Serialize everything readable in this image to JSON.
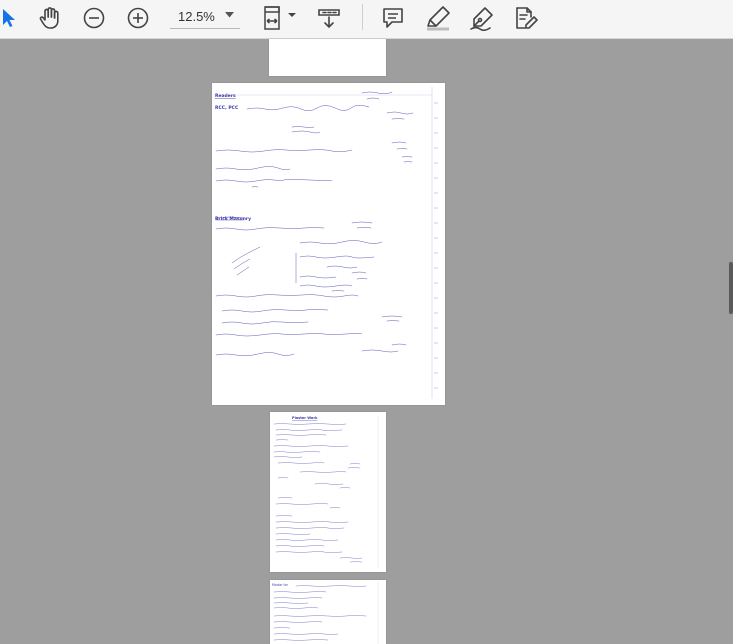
{
  "toolbar": {
    "zoom_value": "12.5%",
    "tools": [
      "select-tool",
      "hand-tool",
      "zoom-out",
      "zoom-in",
      "zoom-dropdown",
      "fit-page",
      "scroll-mode",
      "comment",
      "highlight",
      "draw",
      "fill-sign"
    ]
  },
  "colors": {
    "accent": "#1473e6",
    "canvas": "#9e9e9e",
    "ink": "#3a3aa8"
  },
  "page2": {
    "heading": "Readers",
    "subheading": "RCC, PCC",
    "section2": "Brick Masonry"
  },
  "page3": {
    "heading": "Plaster Work"
  },
  "page4": {
    "heading": "Mortar for"
  }
}
